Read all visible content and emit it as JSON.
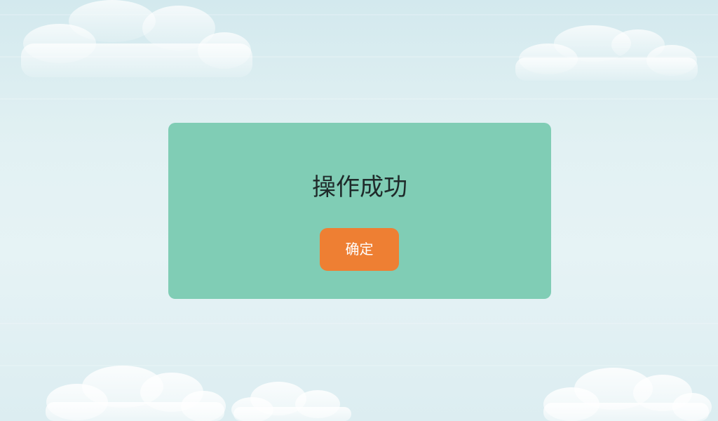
{
  "dialog": {
    "title": "操作成功",
    "confirm_label": "确定"
  },
  "colors": {
    "sky_top": "#d3e9ee",
    "sky_middle": "#e6f3f5",
    "dialog_background": "#80cdb5",
    "button_background": "#ee7f33",
    "button_text": "#ffffff",
    "title_text": "#1f2a2a"
  },
  "decorations": {
    "background_icons": [
      "cloud-icon",
      "cloud-icon",
      "cloud-icon",
      "cloud-icon",
      "cloud-icon"
    ]
  }
}
